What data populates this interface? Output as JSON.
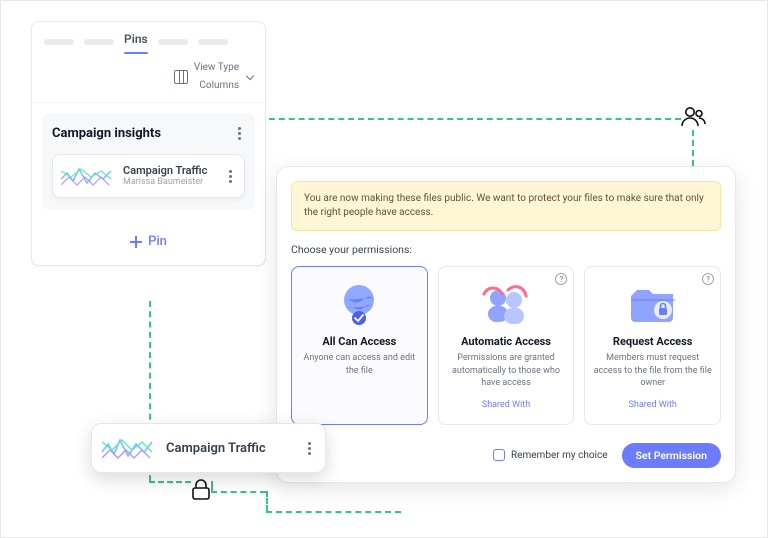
{
  "tabs": {
    "active": "Pins"
  },
  "viewType": {
    "label": "View Type",
    "value": "Columns"
  },
  "card": {
    "title": "Campaign insights",
    "item": {
      "title": "Campaign Traffic",
      "author": "Marissa Baumeister"
    }
  },
  "pin": {
    "label": "Pin"
  },
  "floating": {
    "title": "Campaign Traffic"
  },
  "dialog": {
    "banner": "You are now making these files public. We want to protect your files to make sure that only the right people have access.",
    "choose": "Choose your permissions:",
    "options": [
      {
        "title": "All Can Access",
        "desc": "Anyone can access and edit the file"
      },
      {
        "title": "Automatic Access",
        "desc": "Permissions are granted automatically to those who have access",
        "shared": "Shared With"
      },
      {
        "title": "Request Access",
        "desc": "Members must request access to the file from the file owner",
        "shared": "Shared With"
      }
    ],
    "remember": "Remember my choice",
    "submit": "Set Permission"
  }
}
